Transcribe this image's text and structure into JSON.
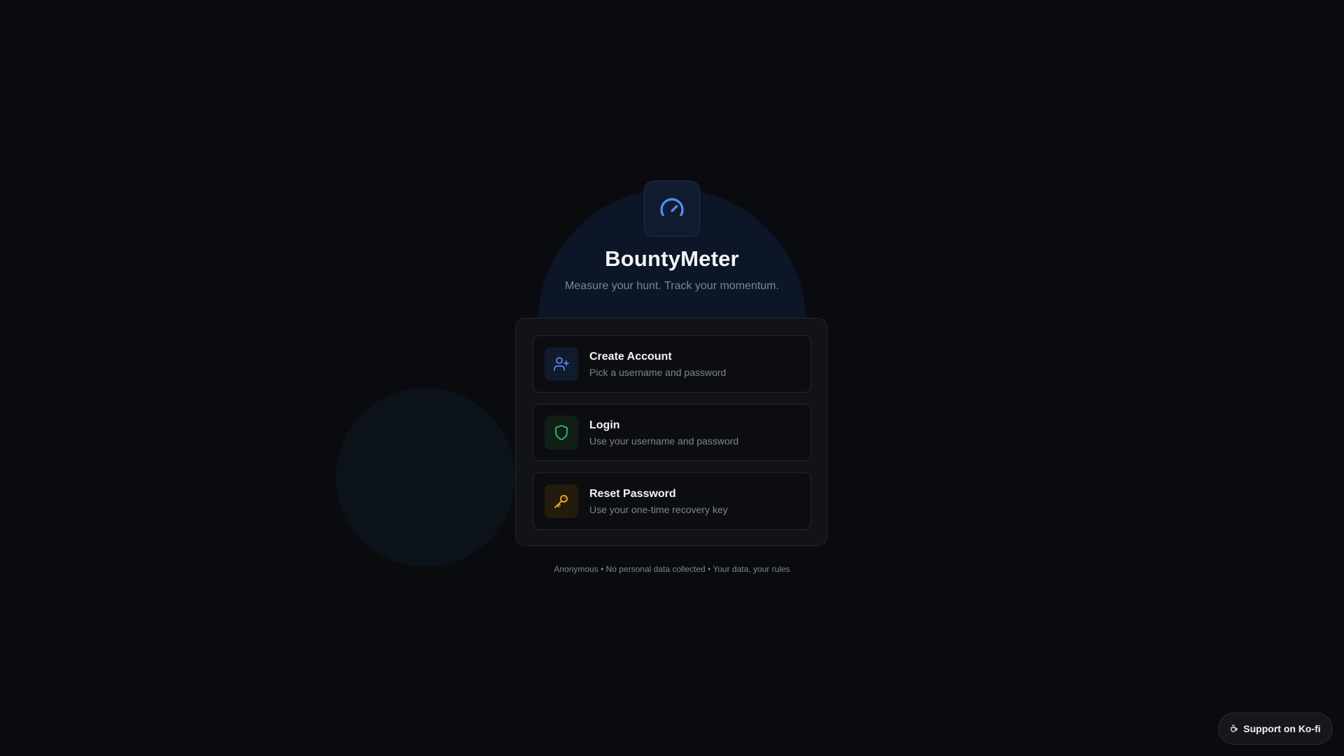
{
  "app": {
    "title": "BountyMeter",
    "tagline": "Measure your hunt. Track your momentum."
  },
  "options": [
    {
      "title": "Create Account",
      "subtitle": "Pick a username and password",
      "icon": "user-plus-icon",
      "accent": "#4f8cf7"
    },
    {
      "title": "Login",
      "subtitle": "Use your username and password",
      "icon": "shield-icon",
      "accent": "#22c55e"
    },
    {
      "title": "Reset Password",
      "subtitle": "Use your one-time recovery key",
      "icon": "key-icon",
      "accent": "#f5b300"
    }
  ],
  "footer": {
    "note": "Anonymous • No personal data collected • Your data, your rules"
  },
  "support": {
    "label": "Support on Ko-fi",
    "icon": "coffee-icon"
  },
  "colors": {
    "background": "#0a0b0e",
    "card": "#121317",
    "brand_accent": "#4f8cf7"
  }
}
